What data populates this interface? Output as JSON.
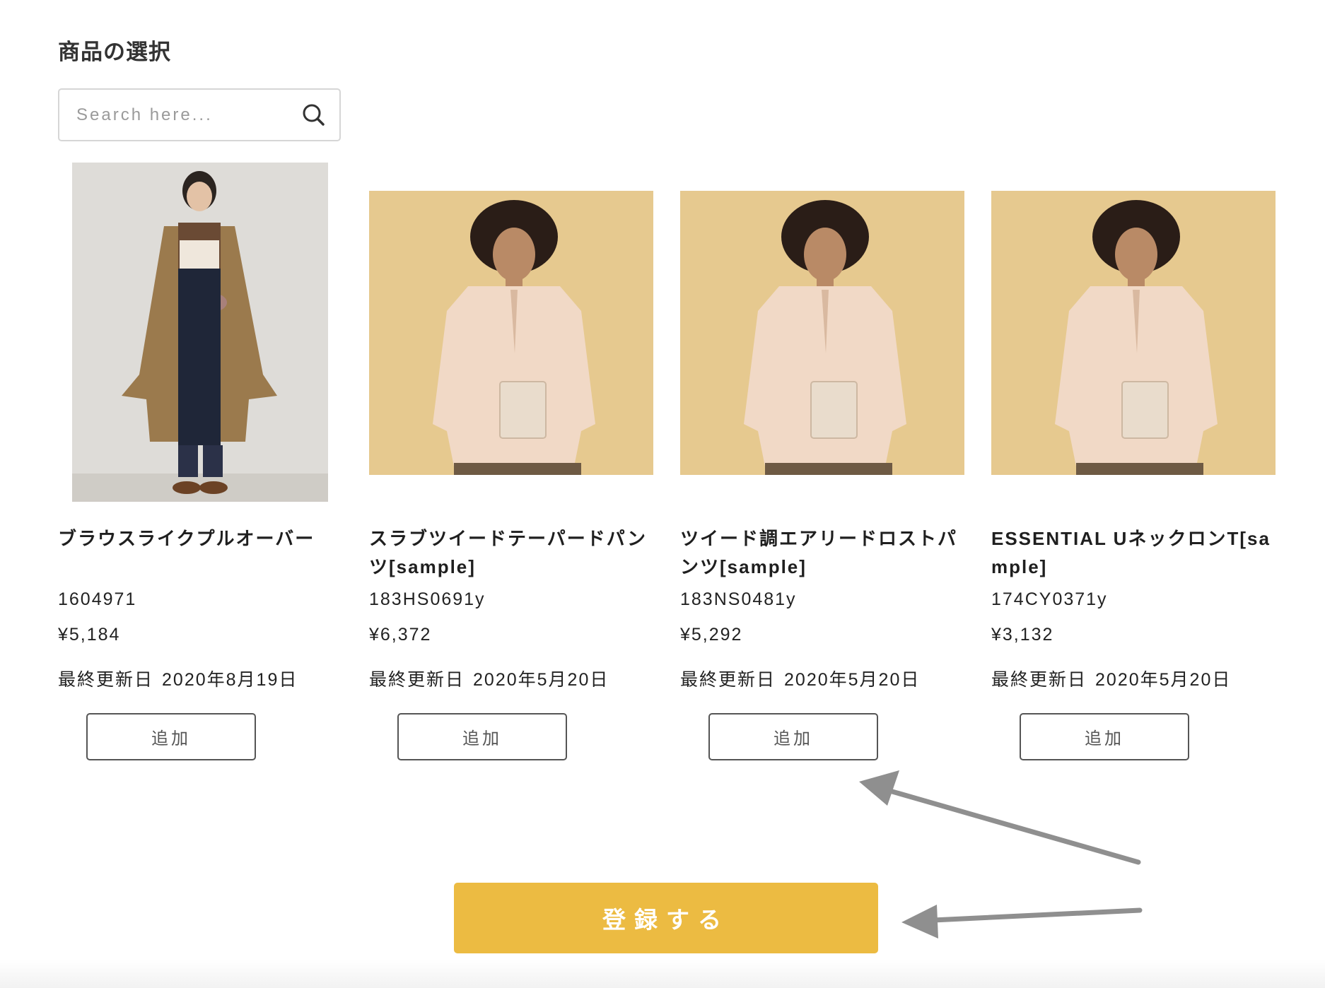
{
  "section": {
    "title": "商品の選択"
  },
  "search": {
    "placeholder": "Search here...",
    "icon": "search-icon"
  },
  "products": [
    {
      "name": "ブラウスライクプルオーバー",
      "code": "1604971",
      "price": "¥5,184",
      "updated_label": "最終更新日",
      "updated_date": "2020年8月19日",
      "add_label": "追加"
    },
    {
      "name": "スラブツイードテーパードパンツ[sample]",
      "code": "183HS0691y",
      "price": "¥6,372",
      "updated_label": "最終更新日",
      "updated_date": "2020年5月20日",
      "add_label": "追加"
    },
    {
      "name": "ツイード調エアリードロストパンツ[sample]",
      "code": "183NS0481y",
      "price": "¥5,292",
      "updated_label": "最終更新日",
      "updated_date": "2020年5月20日",
      "add_label": "追加"
    },
    {
      "name": "ESSENTIAL UネックロンT[sample]",
      "code": "174CY0371y",
      "price": "¥3,132",
      "updated_label": "最終更新日",
      "updated_date": "2020年5月20日",
      "add_label": "追加"
    }
  ],
  "submit": {
    "label": "登録する"
  },
  "colors": {
    "accent": "#ecbb42",
    "button_border": "#555555",
    "arrow": "#8f8f8f",
    "photo_background": "#e6c98f"
  }
}
